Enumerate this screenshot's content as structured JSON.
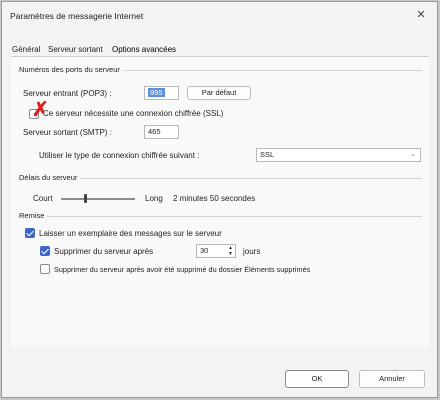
{
  "window": {
    "title": "Paramètres de messagerie Internet",
    "close_glyph": "✕"
  },
  "tabs": [
    {
      "label": "Général"
    },
    {
      "label": "Serveur sortant"
    },
    {
      "label": "Options avancées"
    }
  ],
  "ports": {
    "group_title": "Numéros des ports du serveur",
    "incoming_label": "Serveur entrant (POP3) :",
    "incoming_value": "995",
    "default_button": "Par défaut",
    "ssl_incoming_label": "Ce serveur nécessite une connexion chiffrée (SSL)",
    "ssl_incoming_checked": false,
    "outgoing_label": "Serveur sortant (SMTP) :",
    "outgoing_value": "465",
    "encryption_label": "Utiliser le type de connexion chiffrée suivant :",
    "encryption_value": "SSL"
  },
  "timeout": {
    "group_title": "Délais du serveur",
    "short_label": "Court",
    "long_label": "Long",
    "value_text": "2 minutes 50 secondes",
    "slider_position": 0.32
  },
  "delivery": {
    "group_title": "Remise",
    "leave_copy_label": "Laisser un exemplaire des messages sur le serveur",
    "leave_copy_checked": true,
    "remove_after_label": "Supprimer du serveur après",
    "remove_after_checked": true,
    "days_value": "30",
    "days_unit": "jours",
    "remove_deleted_label": "Supprimer du serveur après avoir été supprimé du dossier Éléments supprimés",
    "remove_deleted_checked": false
  },
  "footer": {
    "ok_label": "OK",
    "cancel_label": "Annuler"
  },
  "annotation": {
    "mark": "✗",
    "color": "#e02020"
  },
  "colors": {
    "accent": "#3f67c8",
    "selection": "#5b8fd9"
  }
}
